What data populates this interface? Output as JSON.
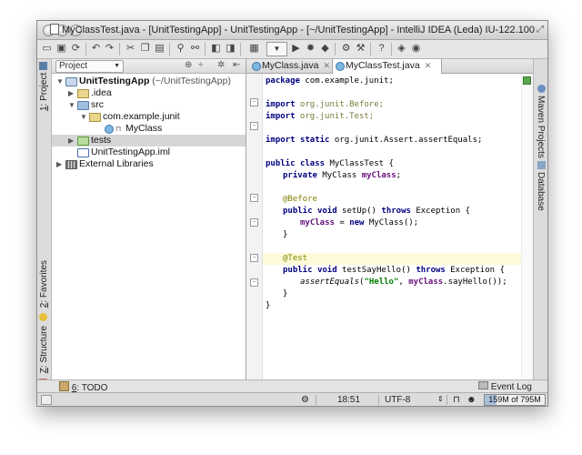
{
  "window": {
    "title": "MyClassTest.java - [UnitTestingApp] - UnitTestingApp - [~/UnitTestingApp] - IntelliJ IDEA (Leda) IU-122.100"
  },
  "left_tool_tabs": [
    {
      "num": "1",
      "label": ": Project"
    },
    {
      "num": "2",
      "label": ": Favorites"
    },
    {
      "num": "Z",
      "label": ": Structure"
    }
  ],
  "right_tool_tabs": [
    "Maven Projects",
    "Database"
  ],
  "project_panel": {
    "selector": "Project",
    "tree": [
      {
        "label": "UnitTestingApp",
        "suffix": " (~/UnitTestingApp)"
      },
      {
        "label": ".idea"
      },
      {
        "label": "src"
      },
      {
        "label": "com.example.junit"
      },
      {
        "label": "MyClass"
      },
      {
        "label": "tests"
      },
      {
        "label": "UnitTestingApp.iml"
      },
      {
        "label": "External Libraries"
      }
    ]
  },
  "editor": {
    "tabs": [
      {
        "label": "MyClass.java",
        "active": false
      },
      {
        "label": "MyClassTest.java",
        "active": true
      }
    ],
    "code": {
      "l1": [
        "package",
        " com.example.junit;"
      ],
      "l2": [
        "import",
        " org.junit.Before;"
      ],
      "l3": [
        "import",
        " org.junit.Test;"
      ],
      "l4": [
        "import",
        "static",
        " org.junit.Assert.assertEquals;"
      ],
      "l5": [
        "public",
        "class",
        " MyClassTest {"
      ],
      "l6": [
        "private",
        " MyClass ",
        "myClass",
        ";"
      ],
      "l7": "@Before",
      "l8": [
        "public",
        "void",
        " setUp() ",
        "throws",
        " Exception {"
      ],
      "l9": [
        "myClass",
        " = ",
        "new",
        " MyClass();"
      ],
      "l10": "}",
      "l11": "@Test",
      "l12": [
        "public",
        "void",
        " testSayHello() ",
        "throws",
        " Exception {"
      ],
      "l13": [
        "assertEquals",
        "(",
        "\"Hello\"",
        ", ",
        "myClass",
        ".sayHello());"
      ],
      "l14": "}",
      "l15": "}"
    }
  },
  "bottom_bar": {
    "todo_num": "6",
    "todo_label": ": TODO",
    "event_log": "Event Log"
  },
  "status_bar": {
    "position": "18:51",
    "encoding": "UTF-8",
    "memory": "159M of 795M",
    "memory_used_fraction": 0.2
  },
  "colors": {
    "accent_selection": "#d6d6d6",
    "current_line": "#fdfbd8",
    "keyword": "#000080"
  }
}
